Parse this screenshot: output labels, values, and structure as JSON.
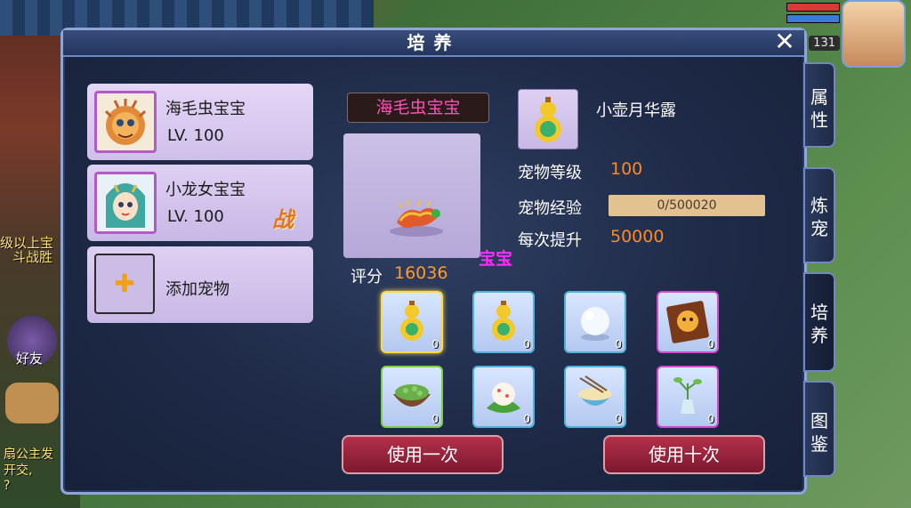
{
  "panel": {
    "title": "培养",
    "close_glyph": "✕"
  },
  "hud": {
    "level": "131",
    "ground_text_1": "级以上宝",
    "ground_text_2": "斗战胜",
    "friend_label": "好友",
    "chat_text_1": "扇公主发",
    "chat_text_2": "开交,",
    "chat_text_3": "?"
  },
  "pets": [
    {
      "name": "海毛虫宝宝",
      "level": "LV. 100",
      "icon": "sea-urchin-pet-portrait"
    },
    {
      "name": "小龙女宝宝",
      "level": "LV. 100",
      "icon": "dragon-girl-pet-portrait",
      "badge": "战"
    }
  ],
  "add_pet": {
    "label": "添加宠物",
    "icon": "plus-icon"
  },
  "selected_pet": {
    "name": "海毛虫宝宝",
    "overhead_text": "宝宝",
    "score_label": "评分",
    "score_value": "16036"
  },
  "item": {
    "name": "小壶月华露",
    "icon": "gourd-icon"
  },
  "stats": {
    "level_label": "宠物等级",
    "level_value": "100",
    "exp_label": "宠物经验",
    "exp_value": "0/500020",
    "exp_progress": 0,
    "gain_label": "每次提升",
    "gain_value": "50000"
  },
  "items": [
    {
      "icon": "gourd-icon",
      "count": "0",
      "border": "yellow"
    },
    {
      "icon": "gourd-icon",
      "count": "0",
      "border": "blue"
    },
    {
      "icon": "pearl-icon",
      "count": "0",
      "border": "blue"
    },
    {
      "icon": "tiger-book-icon",
      "count": "0",
      "border": "purple"
    },
    {
      "icon": "bean-bowl-icon",
      "count": "0",
      "border": "green"
    },
    {
      "icon": "rice-ball-icon",
      "count": "0",
      "border": "blue"
    },
    {
      "icon": "noodle-bowl-icon",
      "count": "0",
      "border": "blue"
    },
    {
      "icon": "herb-vase-icon",
      "count": "0",
      "border": "purple"
    }
  ],
  "buttons": {
    "use_once": "使用一次",
    "use_ten": "使用十次"
  },
  "tabs": [
    {
      "label_1": "属",
      "label_2": "性"
    },
    {
      "label_1": "炼",
      "label_2": "宠"
    },
    {
      "label_1": "培",
      "label_2": "养"
    },
    {
      "label_1": "图",
      "label_2": "鉴"
    }
  ],
  "colors": {
    "accent_orange": "#ff8a1f",
    "pet_name_pink": "#ff4fb8",
    "button_red": "#9a2440",
    "panel_bg": "#1e2a47"
  }
}
